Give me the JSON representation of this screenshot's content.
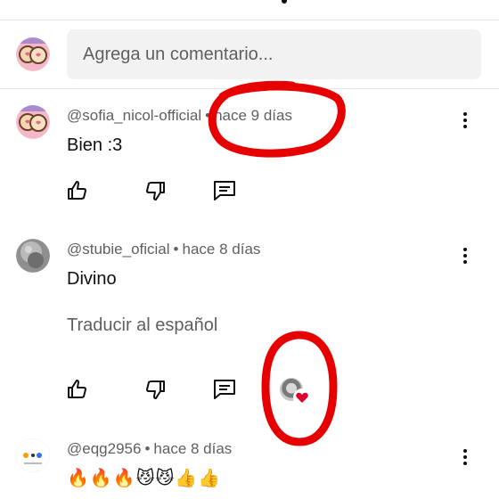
{
  "composer": {
    "placeholder": "Agrega un comentario..."
  },
  "comments": [
    {
      "author": "@sofia_nicol-official",
      "time": "hace 9 días",
      "text": "Bien :3"
    },
    {
      "author": "@stubie_oficial",
      "time": "hace 8 días",
      "text": "Divino",
      "translate_label": "Traducir al español"
    },
    {
      "author": "@eqg2956",
      "time": "hace 8 días",
      "text": "🔥🔥🔥😼😼👍👍"
    }
  ],
  "separator": "•",
  "colors": {
    "annotation": "#e60000",
    "heart": "#e1002d",
    "secondary_text": "#606060"
  }
}
